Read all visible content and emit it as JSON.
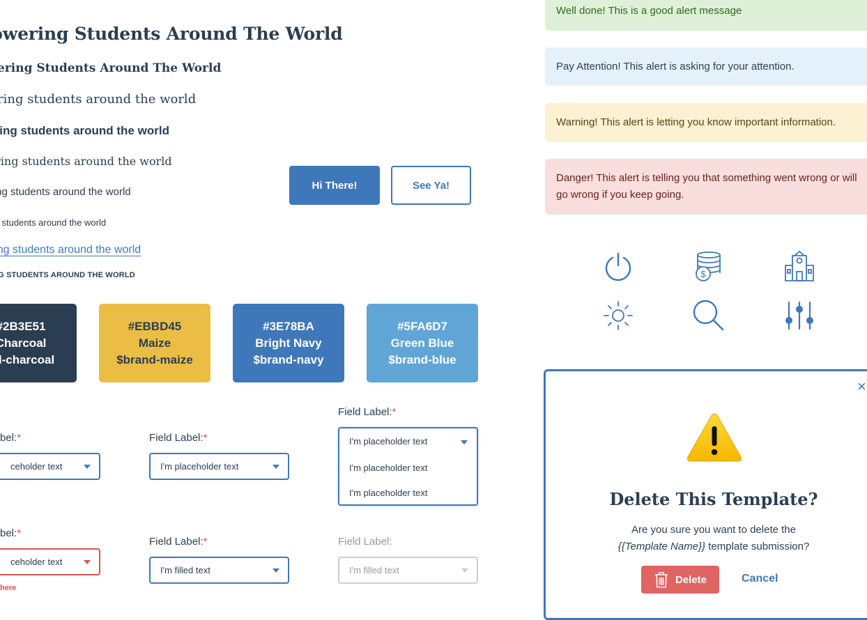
{
  "typography": {
    "h1": "powering Students Around The World",
    "h2": "owering Students Around The World",
    "h3": "wering students around the world",
    "h4": "wering students around the world",
    "h5": "wering students around the world",
    "h6": "vering students around the world",
    "h7": "ering students around the world",
    "link": "vering students around the world",
    "caps": "ERING STUDENTS AROUND THE WORLD"
  },
  "buttons": {
    "primary": "Hi There!",
    "secondary": "See Ya!"
  },
  "colors": [
    {
      "hex": "#2B3E51",
      "name": "Charcoal",
      "variable": "nd-charcoal",
      "display_hex": "#2B3E51",
      "bg": "#2B3E51",
      "fg": "#FFFFFF"
    },
    {
      "hex": "#EBBD45",
      "name": "Maize",
      "variable": "$brand-maize",
      "display_hex": "#EBBD45",
      "bg": "#EBBD45",
      "fg": "#2B3E51"
    },
    {
      "hex": "#3E78BA",
      "name": "Bright Navy",
      "variable": "$brand-navy",
      "display_hex": "#3E78BA",
      "bg": "#3E78BA",
      "fg": "#FFFFFF"
    },
    {
      "hex": "#5FA6D7",
      "name": "Green Blue",
      "variable": "$brand-blue",
      "display_hex": "#5FA6D7",
      "bg": "#5FA6D7",
      "fg": "#FFFFFF"
    }
  ],
  "form": {
    "labels": {
      "cut_label": "bel:",
      "field_label": "Field Label:",
      "required_mark": "*",
      "field_label_disabled": "Field Label:"
    },
    "row1": {
      "select1_value": "ceholder text",
      "select2_value": "I'm placeholder text",
      "dropdown_selected": "I'm placeholder text",
      "dropdown_options": [
        "I'm placeholder text",
        "I'm placeholder text"
      ]
    },
    "row2": {
      "select1_value": "ceholder text",
      "select2_value": "I'm filled text",
      "select3_value": "I'm filled text",
      "error_text": "here"
    }
  },
  "alerts": {
    "success": "Well done! This is a good alert message",
    "info": "Pay Attention! This alert is asking for your attention.",
    "warning": "Warning! This alert is letting you know important information.",
    "danger": "Danger! This alert is telling you that something went wrong or will go wrong if you keep going."
  },
  "icons": [
    "power-icon",
    "coins-icon",
    "school-icon",
    "brightness-icon",
    "search-icon",
    "sliders-icon"
  ],
  "modal": {
    "title": "Delete This Template?",
    "body_line1": "Are you sure you want to delete the",
    "template_name": "{{Template Name}}",
    "body_line2_suffix": " template submission?",
    "delete_label": "Delete",
    "cancel_label": "Cancel",
    "close_glyph": "×"
  }
}
